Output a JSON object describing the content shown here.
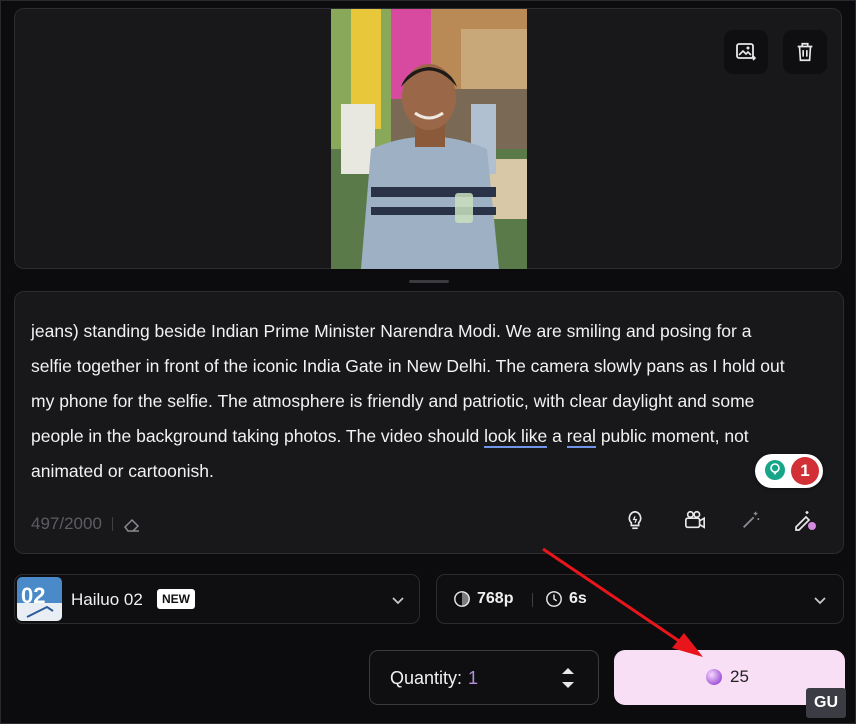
{
  "prompt": {
    "line_1": "jeans) standing beside Indian Prime Minister Narendra Modi. We are smiling and posing for a",
    "line_2": "selfie together in front of the iconic India Gate in New Delhi. The camera slowly pans as I hold out",
    "line_3": "my phone for the selfie. The atmosphere is friendly and patriotic, with clear daylight and some",
    "line_4_a": "people in the background taking photos. The video should ",
    "line_4_ul1": "look like",
    "line_4_b": " a ",
    "line_4_ul2": "real",
    "line_4_c": " public moment, not",
    "line_5": "animated or cartoonish.",
    "char_count": "497/2000"
  },
  "grammar_badge": {
    "count": "1"
  },
  "model": {
    "name": "Hailuo 02",
    "badge": "NEW"
  },
  "settings": {
    "resolution": "768p",
    "duration": "6s"
  },
  "quantity": {
    "label": "Quantity:",
    "value": "1"
  },
  "generate": {
    "credits": "25"
  },
  "watermark": {
    "text": "GU"
  },
  "colors": {
    "accent": "#b58ee0",
    "generate_bg": "#f8dff6",
    "arrow": "#e8161b"
  },
  "icons": [
    "replace-image-icon",
    "delete-icon",
    "lightbulb-icon",
    "camera-icon",
    "magic-wand-icon",
    "edit-sparkle-icon",
    "chevron-down-icon",
    "aperture-icon",
    "clock-icon",
    "stepper-icon",
    "credit-orb-icon"
  ]
}
